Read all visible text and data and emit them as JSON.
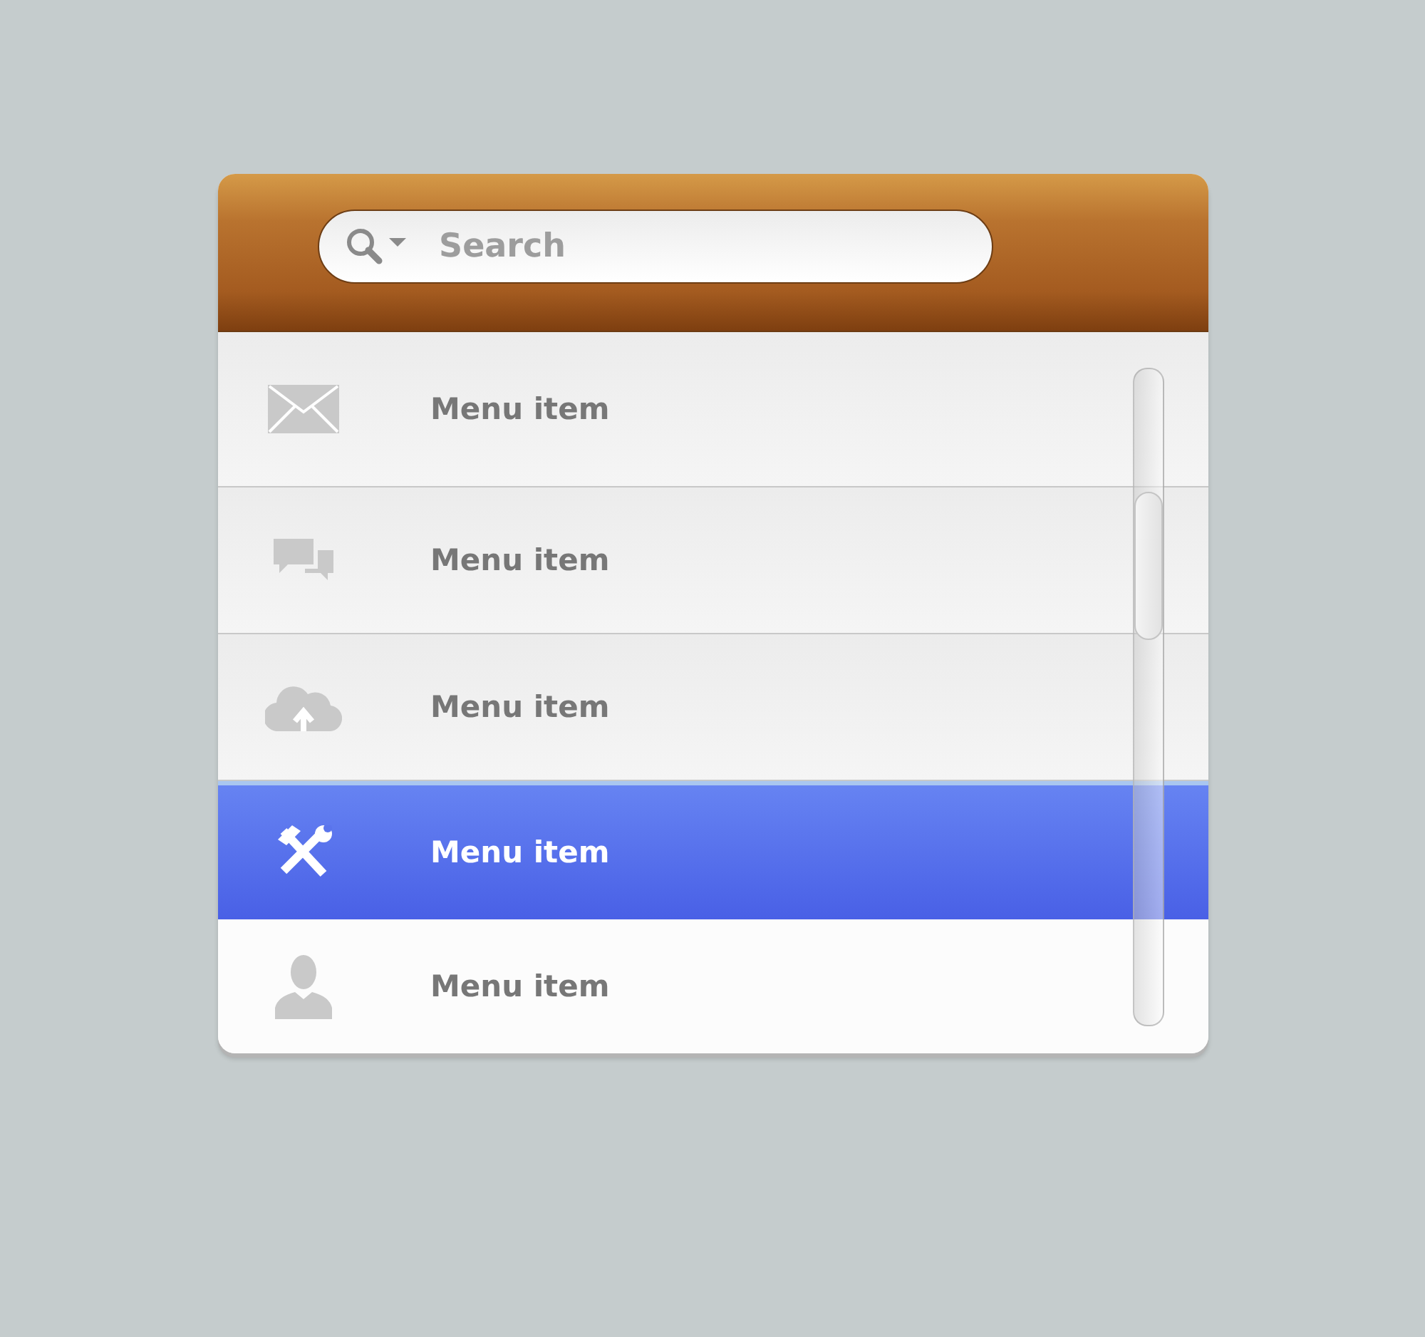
{
  "search": {
    "placeholder": "Search"
  },
  "menu": {
    "items": [
      {
        "label": "Menu item",
        "selected": false
      },
      {
        "label": "Menu item",
        "selected": false
      },
      {
        "label": "Menu item",
        "selected": false
      },
      {
        "label": "Menu item",
        "selected": true
      },
      {
        "label": "Menu item",
        "selected": false
      }
    ]
  }
}
